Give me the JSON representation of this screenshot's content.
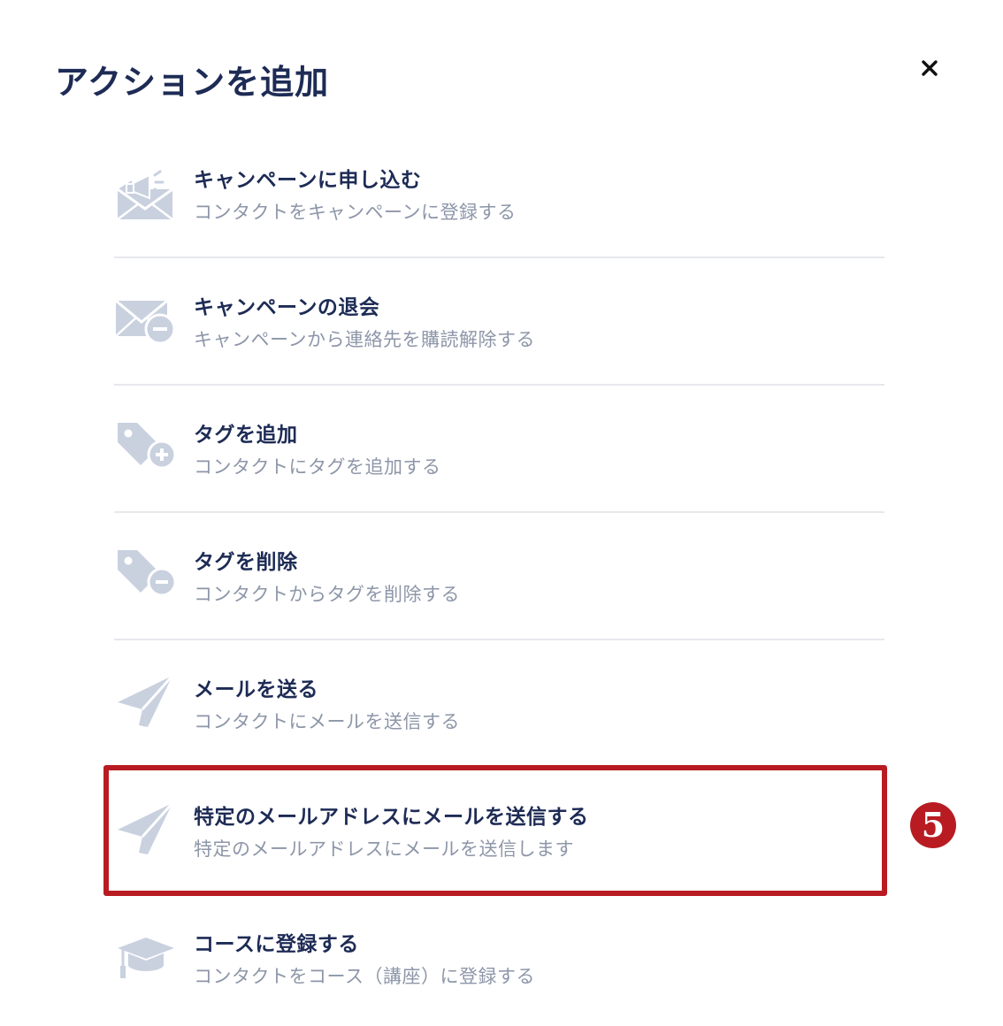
{
  "modal": {
    "title": "アクションを追加",
    "close_icon": "close-icon"
  },
  "actions": [
    {
      "title": "キャンペーンに申し込む",
      "description": "コンタクトをキャンペーンに登録する",
      "icon": "megaphone-envelope-icon"
    },
    {
      "title": "キャンペーンの退会",
      "description": "キャンペーンから連絡先を購読解除する",
      "icon": "envelope-minus-icon"
    },
    {
      "title": "タグを追加",
      "description": "コンタクトにタグを追加する",
      "icon": "tag-plus-icon"
    },
    {
      "title": "タグを削除",
      "description": "コンタクトからタグを削除する",
      "icon": "tag-minus-icon"
    },
    {
      "title": "メールを送る",
      "description": "コンタクトにメールを送信する",
      "icon": "paper-plane-icon"
    },
    {
      "title": "特定のメールアドレスにメールを送信する",
      "description": "特定のメールアドレスにメールを送信します",
      "icon": "paper-plane-icon"
    },
    {
      "title": "コースに登録する",
      "description": "コンタクトをコース（講座）に登録する",
      "icon": "graduation-cap-icon"
    }
  ],
  "annotation": {
    "step_number": "5",
    "highlight_color": "#b81c22"
  },
  "colors": {
    "title_text": "#1d2b55",
    "description_text": "#8d96a8",
    "icon_fill": "#c9d1df",
    "divider": "#e6e8ec"
  }
}
